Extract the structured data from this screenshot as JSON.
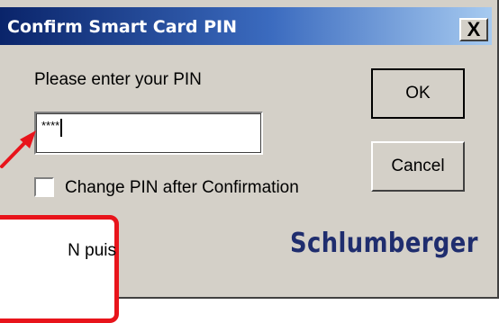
{
  "dialog": {
    "title": "Confirm Smart Card PIN",
    "close_glyph": "X",
    "prompt": "Please enter your PIN",
    "pin_value": "****",
    "change_pin_checked": false,
    "change_pin_label": "Change PIN after Confirmation",
    "ok_label": "OK",
    "cancel_label": "Cancel",
    "brand_logo": "Schlumberger"
  },
  "annotation": {
    "callout_text": "N puis",
    "border_color": "#e8141b"
  },
  "colors": {
    "title_gradient_start": "#0a246a",
    "title_gradient_end": "#a6caf0",
    "logo": "#1f2d6e"
  }
}
